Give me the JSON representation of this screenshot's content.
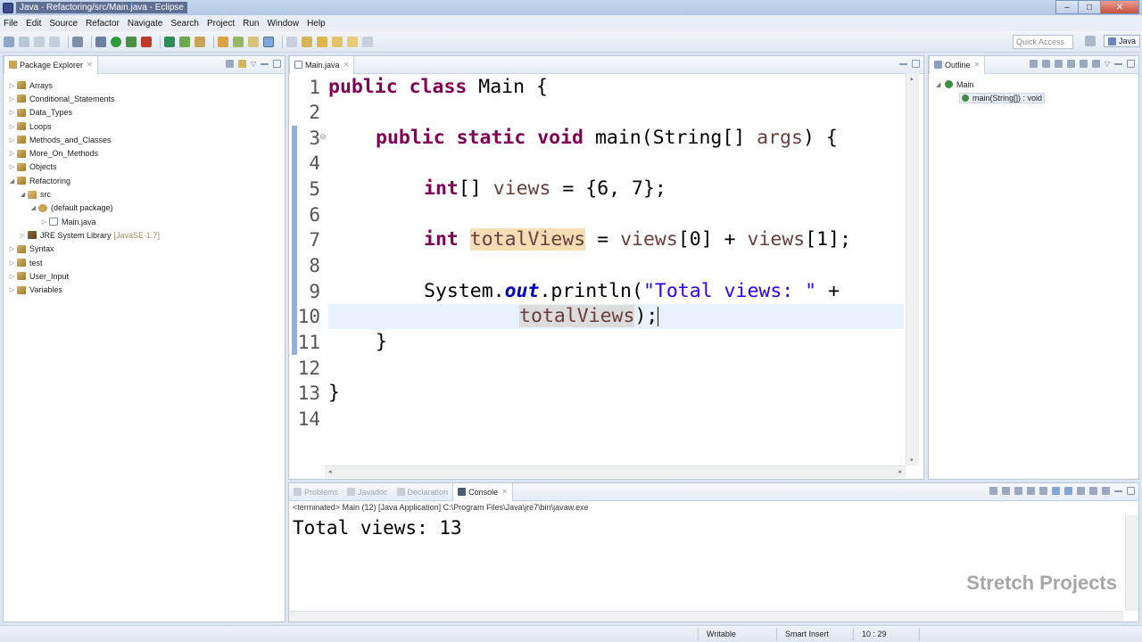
{
  "window": {
    "title": "Java - Refactoring/src/Main.java - Eclipse",
    "controls": {
      "minimize": "–",
      "maximize": "□",
      "close": "✕"
    }
  },
  "menu": [
    "File",
    "Edit",
    "Source",
    "Refactor",
    "Navigate",
    "Search",
    "Project",
    "Run",
    "Window",
    "Help"
  ],
  "toolbar": {
    "quick_access_placeholder": "Quick Access",
    "perspective_label": "Java"
  },
  "package_explorer": {
    "title": "Package Explorer",
    "items": [
      {
        "label": "Arrays",
        "arrow": "▷",
        "decor": ""
      },
      {
        "label": "Conditional_Statements",
        "arrow": "▷",
        "decor": ""
      },
      {
        "label": "Data_Types",
        "arrow": "▷",
        "decor": ""
      },
      {
        "label": "Loops",
        "arrow": "▷",
        "decor": ""
      },
      {
        "label": "Methods_and_Classes",
        "arrow": "▷",
        "decor": ""
      },
      {
        "label": "More_On_Methods",
        "arrow": "▷",
        "decor": ""
      },
      {
        "label": "Objects",
        "arrow": "▷",
        "decor": ""
      },
      {
        "label": "Refactoring",
        "arrow": "◢",
        "decor": ""
      },
      {
        "label": "src",
        "arrow": "◢",
        "decor": ""
      },
      {
        "label": "(default package)",
        "arrow": "◢",
        "decor": ""
      },
      {
        "label": "Main.java",
        "arrow": "▷",
        "decor": ""
      },
      {
        "label": "JRE System Library",
        "arrow": "▷",
        "decor": "[JavaSE-1.7]"
      },
      {
        "label": "Syntax",
        "arrow": "▷",
        "decor": ""
      },
      {
        "label": "test",
        "arrow": "▷",
        "decor": ""
      },
      {
        "label": "User_Input",
        "arrow": "▷",
        "decor": ""
      },
      {
        "label": "Variables",
        "arrow": "▷",
        "decor": ""
      }
    ]
  },
  "editor": {
    "tab_label": "Main.java",
    "line_numbers": [
      "1",
      "2",
      "3",
      "4",
      "5",
      "6",
      "7",
      "8",
      "9",
      "10",
      "11",
      "12",
      "13",
      "14"
    ],
    "code": {
      "l1_kw": "public class",
      "l1_rest": " Main {",
      "l3_kw": "public static void",
      "l3_mid": " main(String[] ",
      "l3_var": "args",
      "l3_end": ") {",
      "l5_kw": "int",
      "l5_mid": "[] ",
      "l5_var": "views",
      "l5_end": " = {6, 7};",
      "l7_kw": "int",
      "l7_var": "totalViews",
      "l7_mid": " = ",
      "l7_var2": "views",
      "l7_idx0": "[0] + ",
      "l7_var3": "views",
      "l7_idx1": "[1];",
      "l9_pre": "System.",
      "l9_field": "out",
      "l9_mid": ".println(",
      "l9_str": "\"Total views: \"",
      "l9_end": " +",
      "l10_var": "totalViews",
      "l10_end": ");",
      "l11": "}",
      "l13": "}"
    }
  },
  "outline": {
    "title": "Outline",
    "class_name": "Main",
    "method": "main(String[]) : void"
  },
  "bottom_tabs": [
    "Problems",
    "Javadoc",
    "Declaration",
    "Console"
  ],
  "console": {
    "status": "<terminated> Main (12) [Java Application] C:\\Program Files\\Java\\jre7\\bin\\javaw.exe",
    "output": "Total views: 13"
  },
  "watermark": "Stretch Projects",
  "statusbar": {
    "writable": "Writable",
    "insert_mode": "Smart Insert",
    "position": "10 : 29"
  },
  "colors": {
    "keyword": "#7f0055",
    "string": "#2a00ff",
    "field": "#0000c0",
    "local_var": "#6a3e3e",
    "decl_highlight": "#f5deb3",
    "read_highlight": "#dcdcdc"
  }
}
